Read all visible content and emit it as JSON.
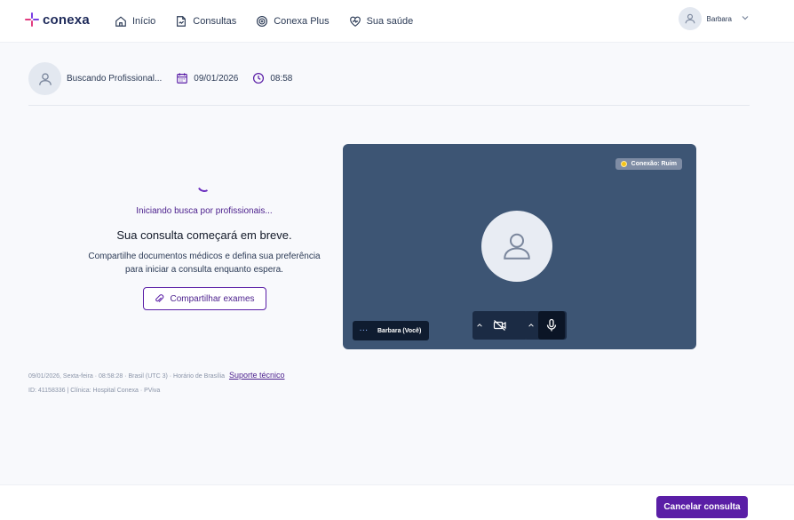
{
  "brand": {
    "name": "conexa",
    "colors": {
      "primary": "#5a1ea6",
      "navy": "#1e2a5a",
      "video_bg": "#3d5574",
      "warning": "#f5c518"
    }
  },
  "nav": {
    "items": [
      {
        "label": "Início",
        "icon": "home-icon"
      },
      {
        "label": "Consultas",
        "icon": "document-icon"
      },
      {
        "label": "Conexa Plus",
        "icon": "plus-badge-icon"
      },
      {
        "label": "Sua saúde",
        "icon": "heart-pulse-icon"
      }
    ]
  },
  "user": {
    "name": "Barbara",
    "icon": "user-icon"
  },
  "appointment": {
    "professional": "Buscando Profissional...",
    "date": "09/01/2026",
    "time": "08:58"
  },
  "waiting": {
    "status": "Iniciando busca por profissionais...",
    "headline": "Sua consulta começará em breve.",
    "description_line1": "Compartilhe documentos médicos e defina sua preferência",
    "description_line2": "para iniciar a consulta enquanto espera.",
    "share_label": "Compartilhar exames"
  },
  "meta": {
    "line1": "09/01/2026, Sexta-feira · 08:58:28 · Brasil (UTC 3) · Horário de Brasília",
    "support_link": "Suporte técnico",
    "line2": "ID: 41158336 | Clínica: Hospital Conexa · PViva"
  },
  "video": {
    "connection_label": "Conexão: Ruim",
    "self_label": "Barbara (Você)",
    "self_dots": "···",
    "camera": "off",
    "microphone": "on"
  },
  "footer": {
    "cancel_label": "Cancelar consulta"
  }
}
